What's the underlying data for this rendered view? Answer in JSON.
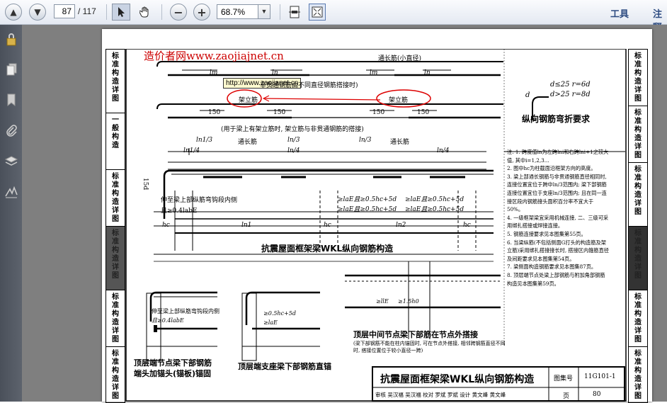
{
  "toolbar": {
    "page_current": "87",
    "page_total": "/ 117",
    "zoom": "68.7%",
    "tools_label": "工具",
    "comment_label": "注释"
  },
  "page": {
    "watermark": "造价者网www.zaojiajnet.cn",
    "tooltip": "http://www.zaojianet.cn",
    "side_tabs_left": [
      "标准构造详图",
      "一般构造",
      "标准构造详图",
      "标准构造详图",
      "标准构造详图",
      "标准构造详图"
    ],
    "side_tabs_right": [
      "标准构造详图",
      "标准构造详图",
      "标准构造详图",
      "标准构造详图",
      "标准构造详图",
      "标准构造详图"
    ],
    "top": {
      "label_tongchang_top": "通长筋(小直径)",
      "label_tongchang_top2": "通长筋(小直径)",
      "label_feiguan": "非贯通钢筋由不同直径钢筋搭接时)",
      "label_jialijin": "架立筋",
      "label_jiali2": "架立筋",
      "dim_150": "150",
      "note_jiali": "(用于梁上有架立筋时, 架立筋与非贯通钢筋的搭接)",
      "l_labels": [
        "lm",
        "ln",
        "lm",
        "ln"
      ]
    },
    "bend": {
      "title": "纵向钢筋弯折要求",
      "rule1": "d≤25  r=6d",
      "rule2": "d>25  r=8d",
      "d_label": "d"
    },
    "main": {
      "tongchang": "通长筋",
      "tongchang2": "通长筋",
      "ln1_3": "ln1/3",
      "ln1_4": "ln1/4",
      "ln_3": "ln/3",
      "ln_4": "ln/4",
      "dim_15d": "15d",
      "note_left1": "伸至梁上部纵筋弯钩段内侧",
      "note_left2": "且≥0.4labE",
      "anchor1": "≥laE且≥0.5hc+5d",
      "anchor2": "≥laE且≥0.5hc+5d",
      "anchor3": "≥laE且≥0.5hc+5d",
      "anchor4": "≥laE且≥0.5hc+5d",
      "hc": "hc",
      "ln1": "ln1",
      "ln2": "ln2",
      "caption": "抗震屋面框架梁WKL纵向钢筋构造"
    },
    "details": {
      "d1_note1": "伸至梁上部纵筋弯钩段内侧",
      "d1_note2": "且≥0.4labE",
      "d1_caption1": "顶层端节点梁下部钢筋",
      "d1_caption2": "端头加锚头(锚板)锚固",
      "d2_note": "≥0.5hc+5d",
      "d2_note2": "≥laE",
      "d2_caption": "顶层端支座梁下部钢筋直锚",
      "d3_lle": "≥llE",
      "d3_15h": "≥1.5h0",
      "d3_caption": "顶层中间节点梁下部筋在节点外搭接",
      "d3_note": "(梁下部钢筋不能在柱内锚固时, 可在节点外搭接, 相邻跨钢筋直径不同时, 搭接位置位于较小直径一跨)"
    },
    "notes": [
      "注: 1. 跨度值ln为左跨lni和右跨lni+1之较大值, 其中i=1,2,3...",
      "2. 图中hc为柱截面沿框架方向的高度。",
      "3. 梁上部通长钢筋与非贯通钢筋直径相同时, 连接位置宜位于跨中ln/3范围内; 梁下部钢筋连接位置宜位于支座ln/3范围内; 且在同一连接区段内钢筋接头面积百分率不宜大于50%。",
      "4. 一级框架梁宜采用机械连接, 二、三级可采用绑扎搭接或焊接连接。",
      "5. 钢筋连接要求见本图集第55页。",
      "6. 当梁纵筋(不包括侧面G打头的构造筋及架立筋)采用绑扎搭接接长时, 搭接区内箍筋直径及间距要求见本图集第54页。",
      "7. 梁侧面构造钢筋要求见本图集87页。",
      "8. 顶层端节点处梁上部钢筋与附加角部钢筋构造见本图集第59页。"
    ],
    "titleblock": {
      "title": "抗震屋面框架梁WKL纵向钢筋构造",
      "atlas_label": "图集号",
      "atlas_no": "11G101-1",
      "page_label": "页",
      "page_no": "80",
      "row": "审核 吴汉福 吴汉福 校对 罗斌 罗斌 设计 黄文峰 黄文峰"
    }
  }
}
